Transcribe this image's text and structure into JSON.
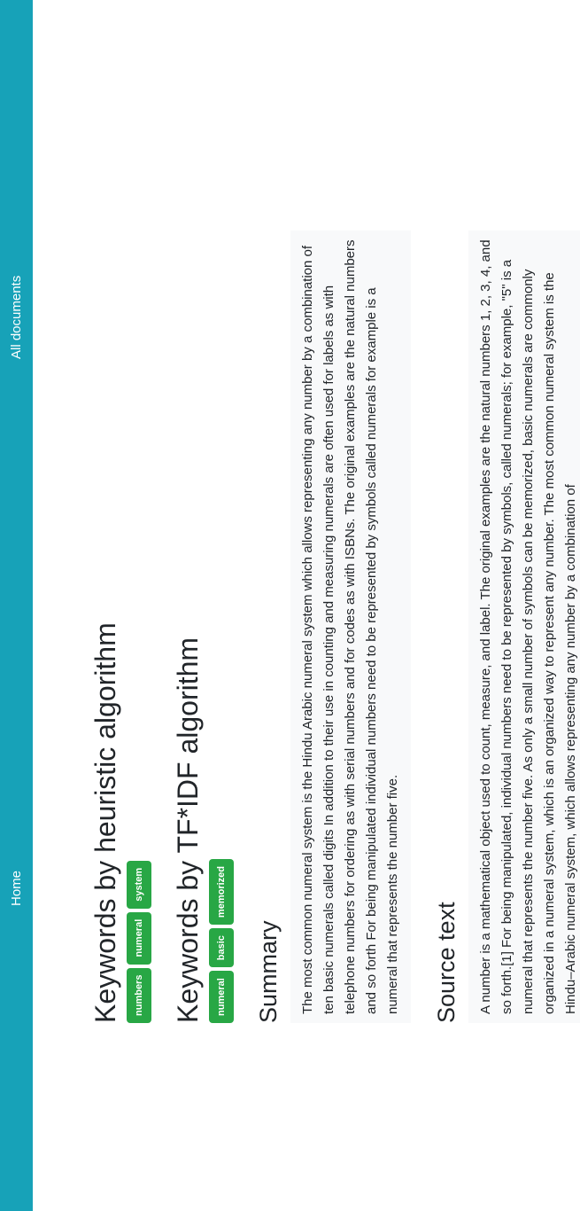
{
  "nav": {
    "home_label": "Home",
    "all_documents_label": "All documents"
  },
  "sections": {
    "heuristic_title": "Keywords by heuristic algorithm",
    "tfidf_title": "Keywords by TF*IDF algorithm",
    "summary_title": "Summary",
    "source_title": "Source text"
  },
  "keywords_heuristic": [
    "numbers",
    "numeral",
    "system"
  ],
  "keywords_tfidf": [
    "numeral",
    "basic",
    "memorized"
  ],
  "summary_text": "The most common numeral system is the Hindu Arabic numeral system which allows representing any number by a combination of ten basic numerals called digits In addition to their use in counting and measuring numerals are often used for labels as with telephone numbers for ordering as with serial numbers and for codes as with ISBNs. The original examples are the natural numbers and so forth For being manipulated individual numbers need to be represented by symbols called numerals for example is a numeral that represents the number five.",
  "source_text": "A number is a mathematical object used to count, measure, and label. The original examples are the natural numbers 1, 2, 3, 4, and so forth.[1] For being manipulated, individual numbers need to be represented by symbols, called numerals; for example, \"5\" is a numeral that represents the number five. As only a small number of symbols can be memorized, basic numerals are commonly organized in a numeral system, which is an organized way to represent any number. The most common numeral system is the Hindu–Arabic numeral system, which allows representing any number by a combination of",
  "colors": {
    "navbar": "#17a2b8",
    "badge": "#28a745",
    "text_box": "#f8f9fa"
  }
}
